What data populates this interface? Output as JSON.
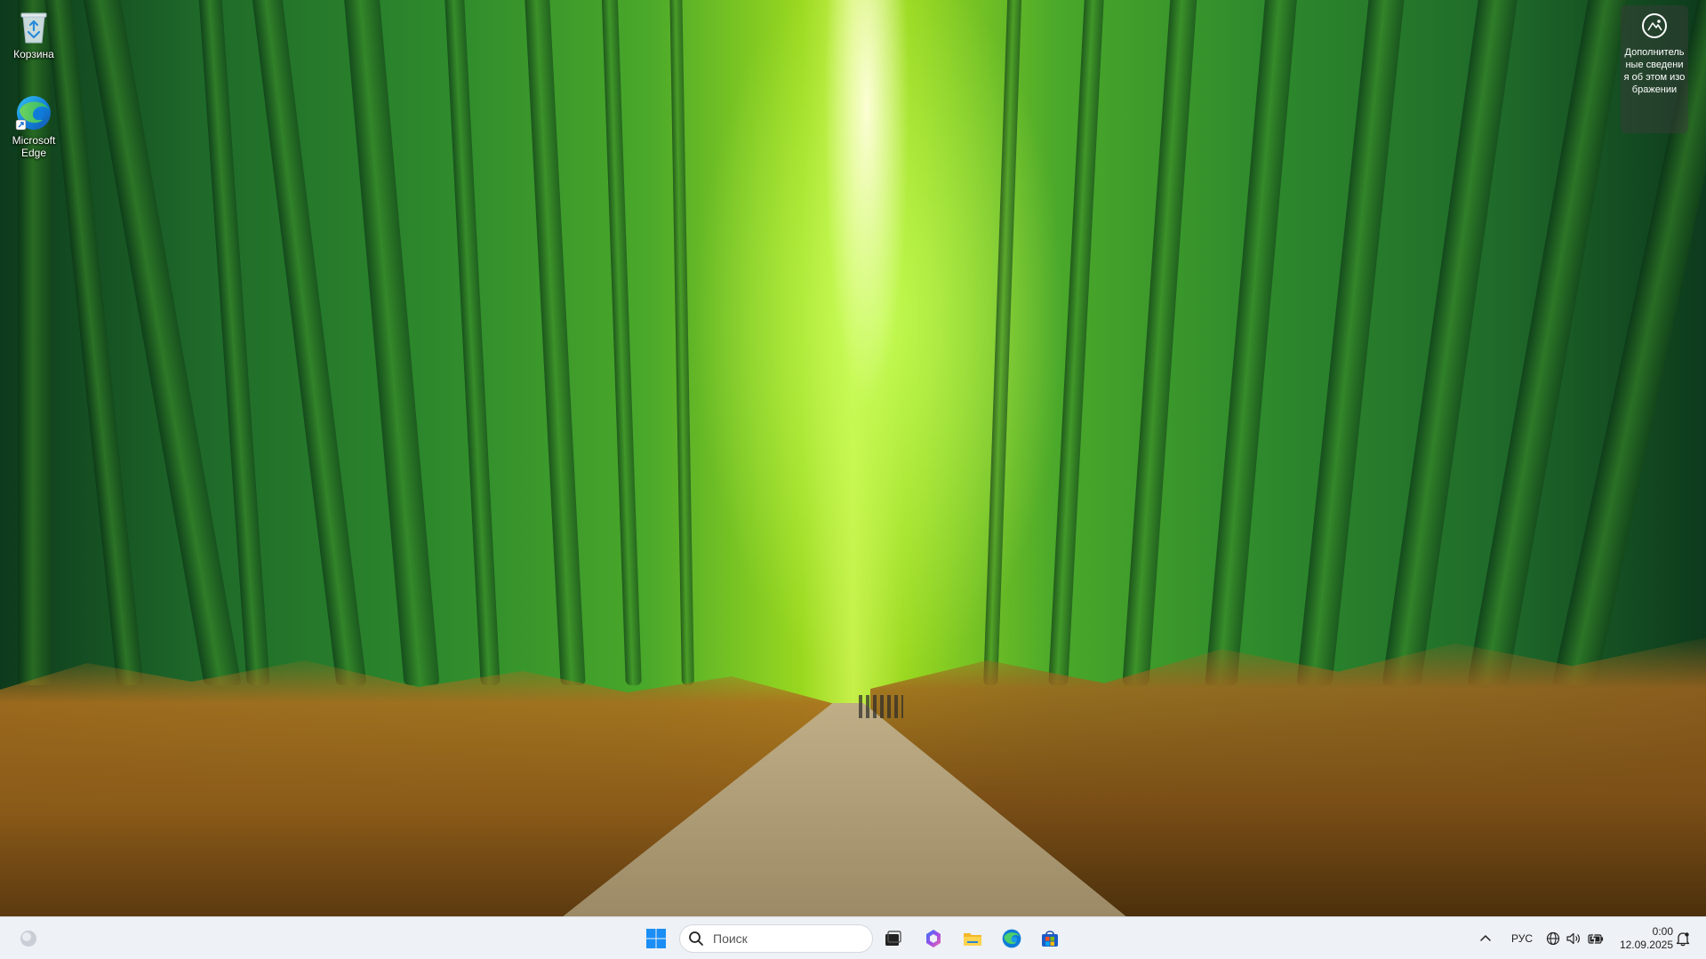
{
  "desktop": {
    "icons": [
      {
        "label": "Корзина",
        "icon": "recycle-bin-icon"
      },
      {
        "label": "Microsoft Edge",
        "icon": "edge-icon"
      }
    ],
    "spotlight": {
      "text": "Дополнительные сведения об этом изображении",
      "icon": "spotlight-camera-icon"
    }
  },
  "taskbar": {
    "search": {
      "placeholder": "Поиск"
    },
    "apps": [
      {
        "name": "task-view",
        "icon": "task-view-icon"
      },
      {
        "name": "copilot",
        "icon": "copilot-icon"
      },
      {
        "name": "file-explorer",
        "icon": "folder-icon"
      },
      {
        "name": "edge",
        "icon": "edge-icon"
      },
      {
        "name": "store",
        "icon": "store-icon"
      }
    ],
    "tray": {
      "language": "РУС",
      "time": "0:00",
      "date": "12.09.2025"
    }
  }
}
